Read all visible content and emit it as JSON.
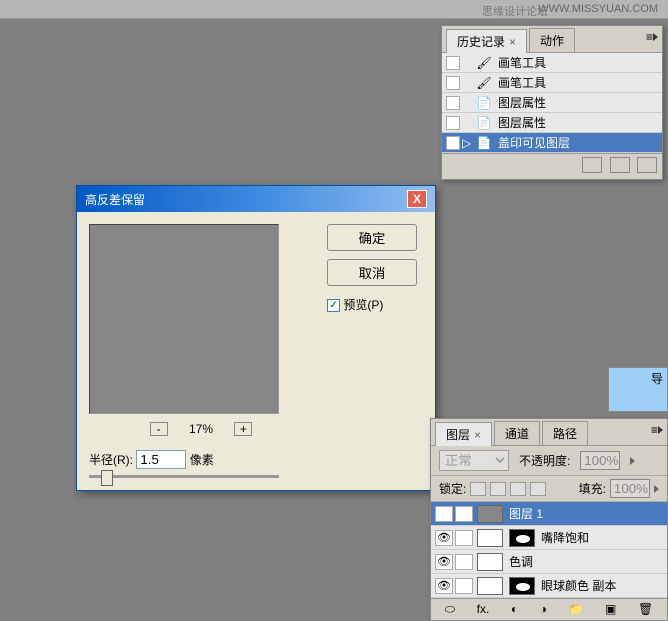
{
  "watermark_left": "思缘设计论坛",
  "watermark_right": "WWW.MISSYUAN.COM",
  "history_panel": {
    "tabs": [
      {
        "label": "历史记录",
        "active": true
      },
      {
        "label": "动作",
        "active": false
      }
    ],
    "items": [
      {
        "icon": "brush",
        "label": "画笔工具",
        "selected": false,
        "arrow": false
      },
      {
        "icon": "brush",
        "label": "画笔工具",
        "selected": false,
        "arrow": false
      },
      {
        "icon": "doc",
        "label": "图层属性",
        "selected": false,
        "arrow": false
      },
      {
        "icon": "doc",
        "label": "图层属性",
        "selected": false,
        "arrow": false
      },
      {
        "icon": "doc",
        "label": "盖印可见图层",
        "selected": true,
        "arrow": true
      }
    ]
  },
  "dialog": {
    "title": "高反差保留",
    "ok": "确定",
    "cancel": "取消",
    "preview_label": "预览(P)",
    "zoom": "17%",
    "radius_label": "半径(R):",
    "radius_value": "1.5",
    "radius_unit": "像素"
  },
  "mini_panel": {
    "label": "导"
  },
  "layers_panel": {
    "tabs": [
      {
        "label": "图层",
        "active": true
      },
      {
        "label": "通道",
        "active": false
      },
      {
        "label": "路径",
        "active": false
      }
    ],
    "blend_mode": "正常",
    "opacity_label": "不透明度:",
    "opacity_value": "100%",
    "lock_label": "锁定:",
    "fill_label": "填充:",
    "fill_value": "100%",
    "layers": [
      {
        "name": "图层 1",
        "selected": true,
        "thumb_color": "#868686",
        "has_mask": false
      },
      {
        "name": "嘴降饱和",
        "selected": false,
        "thumb_color": "#fff",
        "has_mask": true
      },
      {
        "name": "色调",
        "selected": false,
        "thumb_color": "#fff",
        "has_mask": false
      },
      {
        "name": "眼球颜色 副本",
        "selected": false,
        "thumb_color": "#fff",
        "has_mask": true
      }
    ]
  }
}
